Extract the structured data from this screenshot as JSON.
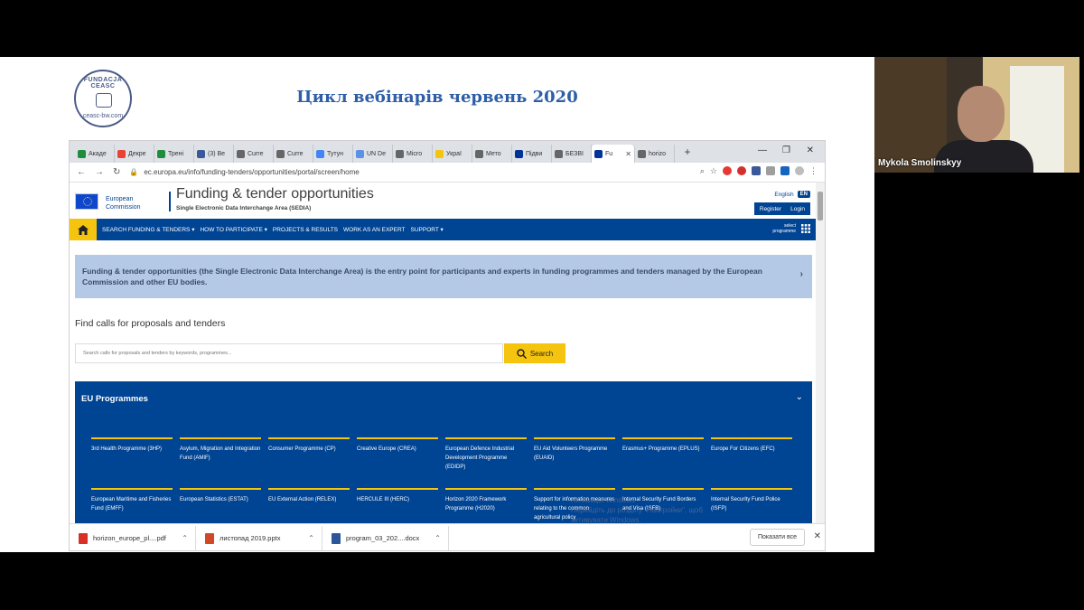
{
  "slide": {
    "title": "Цикл вебінарів червень 2020",
    "logo_text_top": "FUNDACJA CEASC",
    "logo_text_bottom": "ceasc-bw.com"
  },
  "browser": {
    "tabs": [
      {
        "label": "Акаде",
        "color": "#1e8e3e"
      },
      {
        "label": "Декре",
        "color": "#ea4335"
      },
      {
        "label": "Трені",
        "color": "#1e8e3e"
      },
      {
        "label": "(3) Ве",
        "color": "#3b5998"
      },
      {
        "label": "Curre",
        "color": "#666666"
      },
      {
        "label": "Curre",
        "color": "#666666"
      },
      {
        "label": "Тутун",
        "color": "#4285f4"
      },
      {
        "label": "UN De",
        "color": "#5b92e5"
      },
      {
        "label": "Micro",
        "color": "#666666"
      },
      {
        "label": "Украї",
        "color": "#f4c40f"
      },
      {
        "label": "Мето",
        "color": "#666666"
      },
      {
        "label": "Підви",
        "color": "#003399"
      },
      {
        "label": "БЕЗВІ",
        "color": "#666666"
      },
      {
        "label": "Fu",
        "color": "#003399"
      },
      {
        "label": "horizo",
        "color": "#666666"
      }
    ],
    "active_tab_index": 13,
    "url": "ec.europa.eu/info/funding-tenders/opportunities/portal/screen/home"
  },
  "portal": {
    "ec_name_line1": "European",
    "ec_name_line2": "Commission",
    "title": "Funding & tender opportunities",
    "subtitle": "Single Electronic Data Interchange Area (SEDIA)",
    "language": "English",
    "language_code": "EN",
    "register": "Register",
    "login": "Login",
    "nav": [
      "SEARCH FUNDING & TENDERS ▾",
      "HOW TO PARTICIPATE ▾",
      "PROJECTS & RESULTS",
      "WORK AS AN EXPERT",
      "SUPPORT ▾"
    ],
    "select_programme_line1": "select",
    "select_programme_line2": "programme",
    "info_text": "Funding & tender opportunities (the Single Electronic Data Interchange Area) is the entry point for participants and experts in funding programmes and tenders managed by the European Commission and other EU bodies.",
    "find_title": "Find calls for proposals and tenders",
    "search_placeholder": "Search calls for proposals and tenders by keywords, programmes...",
    "search_button": "Search",
    "programmes_title": "EU Programmes",
    "programmes": [
      "3rd Health Programme (3HP)",
      "Asylum, Migration and Integration Fund (AMIF)",
      "Consumer Programme (CP)",
      "Creative Europe (CREA)",
      "European Defence Industrial Development Programme (EDIDP)",
      "EU Aid Volunteers Programme (EUAID)",
      "Erasmus+ Programme (EPLUS)",
      "Europe For Citizens (EFC)",
      "European Maritime and Fisheries Fund (EMFF)",
      "European Statistics (ESTAT)",
      "EU External Action (RELEX)",
      "HERCULE III (HERC)",
      "Horizon 2020 Framework Programme (H2020)",
      "Support for information measures relating to the common agricultural policy",
      "Internal Security Fund Borders and Visa (ISFB)",
      "Internal Security Fund Police (ISFP)"
    ]
  },
  "downloads": [
    {
      "name": "horizon_europe_pl....pdf",
      "color": "#d93025"
    },
    {
      "name": "листопад 2019.pptx",
      "color": "#d24726"
    },
    {
      "name": "program_03_202....docx",
      "color": "#2b579a"
    }
  ],
  "show_all": "Показати все",
  "activate_windows": "Активація Windows\nПерейдіть до розділу \"Настройки\", щоб активувати Windows.",
  "webcam": {
    "participant_name": "Mykola Smolinskyy"
  }
}
